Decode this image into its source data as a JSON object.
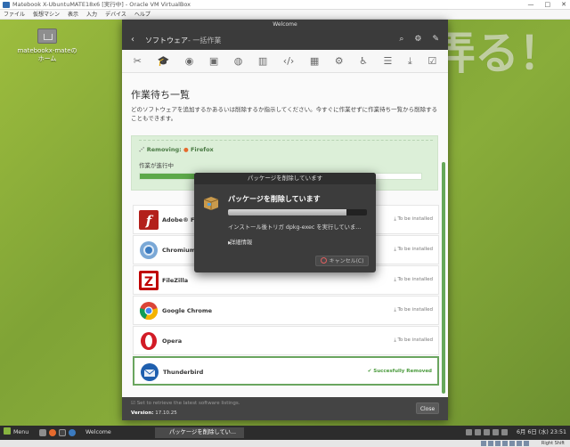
{
  "host": {
    "title": "Matebook X-UbuntuMATE18x6 [実行中] - Oracle VM VirtualBox",
    "menu": [
      "ファイル",
      "仮想マシン",
      "表示",
      "入力",
      "デバイス",
      "ヘルプ"
    ],
    "host_key": "Right Shift"
  },
  "desktop": {
    "watermark": "思い立ったら弄る！",
    "home_icon_label": "matebookx-mateの\nホーム"
  },
  "window": {
    "title": "Welcome",
    "breadcrumb_main": "ソフトウェア",
    "breadcrumb_sub": "- 一括作業",
    "categories": [
      "accessories-icon",
      "education-icon",
      "games-icon",
      "graphics-icon",
      "internet-icon",
      "office-icon",
      "programming-icon",
      "multimedia-icon",
      "system-icon",
      "accessibility-icon",
      "servers-icon",
      "download-icon",
      "queue-icon"
    ]
  },
  "queue": {
    "title": "作業待ち一覧",
    "description": "どのソフトウェアを追加するかあるいは削除するか指示してください。今すぐに作業せずに作業待ち一覧から削除することもできます。",
    "removing_label": "Removing:",
    "removing_package": "Firefox",
    "status": "作業が進行中",
    "progress": 0.5
  },
  "packages": [
    {
      "name": "Adobe® Flash",
      "state": "To be installed",
      "done": false
    },
    {
      "name": "Chromium",
      "state": "To be installed",
      "done": false
    },
    {
      "name": "FileZilla",
      "state": "To be installed",
      "done": false
    },
    {
      "name": "Google Chrome",
      "state": "To be installed",
      "done": false
    },
    {
      "name": "Opera",
      "state": "To be installed",
      "done": false
    },
    {
      "name": "Thunderbird",
      "state": "Succesfully Removed",
      "done": true
    }
  ],
  "footer": {
    "check": "Set to retrieve the latest software listings.",
    "version_label": "Version:",
    "version": "17.10.25",
    "close": "Close"
  },
  "dialog": {
    "title": "パッケージを削除しています",
    "heading": "パッケージを削除しています",
    "progress": 0.85,
    "message": "インストール後トリガ dpkg-exec を実行していま...",
    "details": "詳細情報",
    "cancel": "キャンセル(C)"
  },
  "taskbar": {
    "menu": "Menu",
    "task1": "Welcome",
    "task2": "パッケージを削除してい...",
    "clock": "6月 6日 (水) 23:51"
  },
  "colors": {
    "accent": "#5ca849",
    "desktop": "#8cb03a",
    "dark": "#3b3b3b"
  }
}
